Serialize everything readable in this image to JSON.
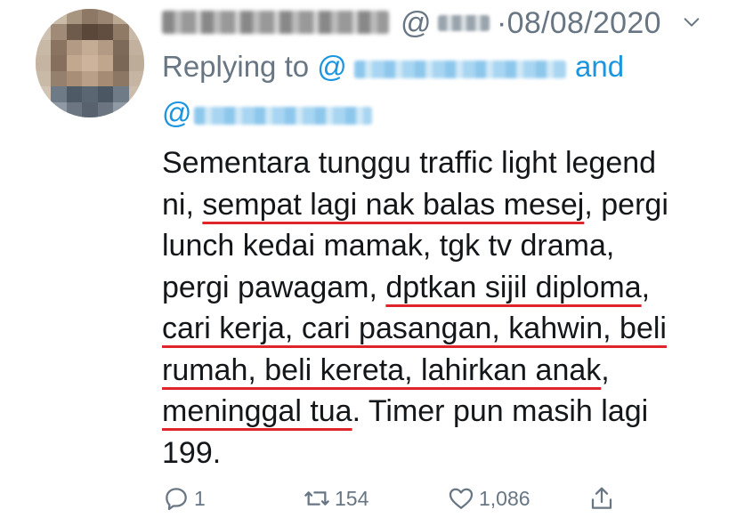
{
  "tweet": {
    "handle_prefix": "@",
    "date": "·08/08/2020",
    "replying": {
      "prefix": "Replying to ",
      "at": "@",
      "and": "and",
      "at2": "@"
    },
    "lines": [
      [
        "Sementara tunggu traffic light legend"
      ],
      [
        "ni, ",
        "sempat lagi nak balas mesej",
        ", pergi"
      ],
      [
        "lunch kedai mamak, tgk tv drama,"
      ],
      [
        "pergi pawagam, ",
        "dptkan sijil diploma",
        ","
      ],
      [
        "cari kerja, cari pasangan, kahwin, beli"
      ],
      [
        "rumah, beli kereta, lahirkan anak",
        ","
      ],
      [
        "meninggal tua",
        ". Timer pun masih lagi"
      ],
      [
        "199."
      ]
    ],
    "actions": {
      "reply_count": "1",
      "retweet_count": "154",
      "like_count": "1,086"
    },
    "icons": {
      "reply": "reply-icon",
      "retweet": "retweet-icon",
      "like": "heart-icon",
      "share": "share-icon",
      "menu": "chevron-down-icon"
    },
    "colors": {
      "link": "#1b95e0",
      "muted": "#687684",
      "text": "#14171a",
      "underline": "#e0242b"
    }
  }
}
